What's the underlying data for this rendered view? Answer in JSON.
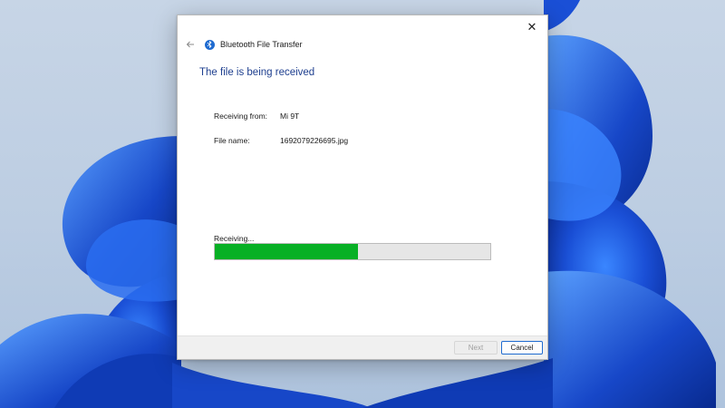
{
  "window": {
    "title": "Bluetooth File Transfer",
    "close_glyph": "✕",
    "icons": {
      "back": "back-arrow-icon",
      "app": "bluetooth-icon",
      "close": "close-icon"
    }
  },
  "content": {
    "heading": "The file is being received",
    "receiving_from_label": "Receiving from:",
    "receiving_from_value": "Mi 9T",
    "file_name_label": "File name:",
    "file_name_value": "1692079226695.jpg",
    "status": "Receiving...",
    "progress_fraction": 0.52
  },
  "footer": {
    "next_label": "Next",
    "next_enabled": false,
    "cancel_label": "Cancel"
  },
  "colors": {
    "accent": "#1f6bd0",
    "heading": "#1e3f8f",
    "progress": "#07b025",
    "wallpaper_blue": "#1a4fd6"
  }
}
